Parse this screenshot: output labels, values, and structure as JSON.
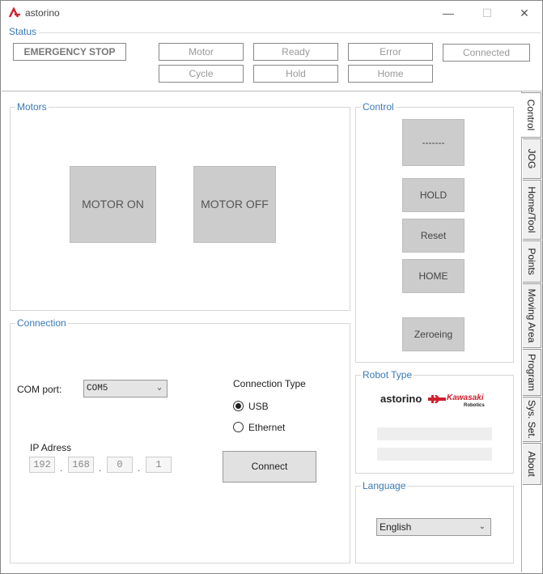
{
  "app": {
    "title": "astorino"
  },
  "window_controls": {
    "minimize": "—",
    "maximize": "☐",
    "close": "✕"
  },
  "status": {
    "legend": "Status",
    "emergency_stop": "EMERGENCY STOP",
    "indicators": [
      "Motor",
      "Ready",
      "Error",
      "Connected",
      "Cycle",
      "Hold",
      "Home"
    ]
  },
  "motors": {
    "legend": "Motors",
    "on_label": "MOTOR ON",
    "off_label": "MOTOR OFF"
  },
  "control": {
    "legend": "Control",
    "cycle_button": "-------",
    "hold_button": "HOLD",
    "reset_button": "Reset",
    "home_button": "HOME",
    "zeroing_button": "Zeroeing"
  },
  "connection": {
    "legend": "Connection",
    "com_label": "COM port:",
    "com_value": "COM5",
    "type_label": "Connection Type",
    "usb_label": "USB",
    "ethernet_label": "Ethernet",
    "selected_type": "USB",
    "ip_label": "IP Adress",
    "ip": [
      "192",
      "168",
      "0",
      "1"
    ],
    "connect_button": "Connect"
  },
  "robot_type": {
    "legend": "Robot Type",
    "brand_text": "astorino",
    "partner_text": "Kawasaki",
    "partner_sub": "Robotics"
  },
  "language": {
    "legend": "Language",
    "value": "English"
  },
  "tabs": [
    "Control",
    "JOG",
    "Home/Tool",
    "Points",
    "Moving Area",
    "Program",
    "Sys. Set.",
    "About"
  ],
  "colors": {
    "accent": "#3a78b5",
    "brand_red": "#d0202e",
    "button_gray": "#cccccc"
  }
}
